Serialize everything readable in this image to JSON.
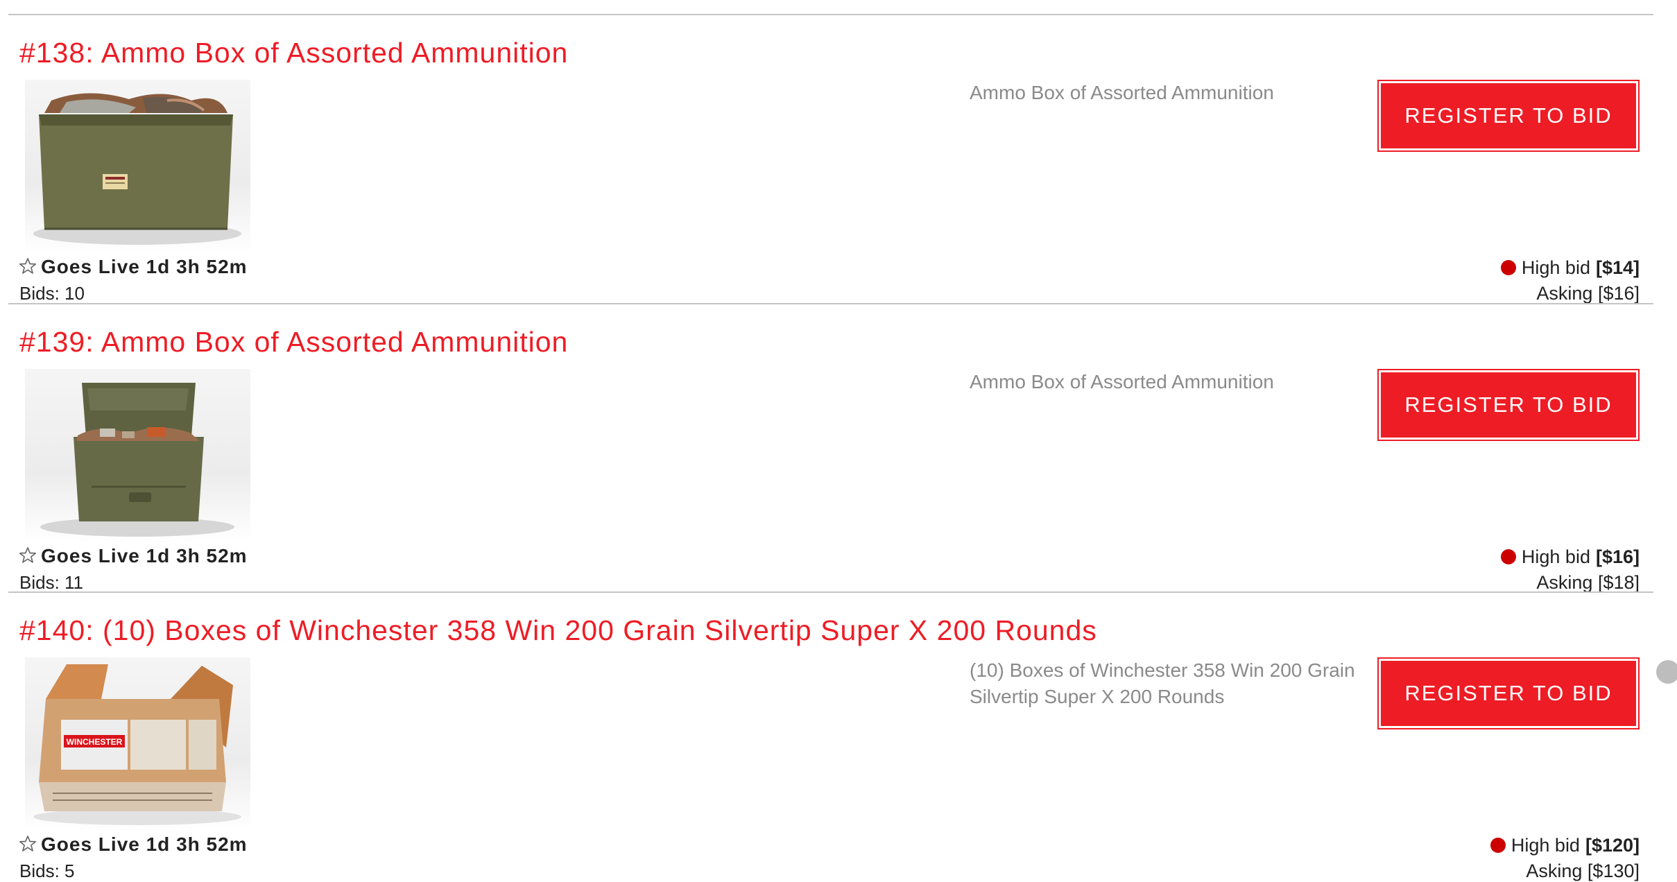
{
  "lots": [
    {
      "title": "#138: Ammo Box of Assorted Ammunition",
      "description": "Ammo Box of Assorted Ammunition",
      "register_label": "Register to Bid",
      "goes_live": "Goes Live 1d 3h 52m",
      "bids": "Bids: 10",
      "high_bid_label": "High bid",
      "high_bid_value": "[$14]",
      "asking": "Asking [$16]",
      "image": "closed-ammo-box-photo"
    },
    {
      "title": "#139: Ammo Box of Assorted Ammunition",
      "description": "Ammo Box of Assorted Ammunition",
      "register_label": "Register to Bid",
      "goes_live": "Goes Live 1d 3h 52m",
      "bids": "Bids: 11",
      "high_bid_label": "High bid",
      "high_bid_value": "[$16]",
      "asking": "Asking [$18]",
      "image": "open-ammo-box-photo"
    },
    {
      "title": "#140: (10) Boxes of Winchester 358 Win 200 Grain Silvertip Super X 200 Rounds",
      "description": "(10) Boxes of Winchester 358 Win 200 Grain Silvertip Super X 200 Rounds",
      "register_label": "Register to Bid",
      "goes_live": "Goes Live 1d 3h 52m",
      "bids": "Bids: 5",
      "high_bid_label": "High bid",
      "high_bid_value": "[$120]",
      "asking": "Asking [$130]",
      "image": "winchester-cartridge-boxes-photo",
      "image_brand_text": "WINCHESTER"
    }
  ],
  "icons": {
    "watch": "star-outline-icon",
    "status": "red-dot-icon"
  },
  "colors": {
    "accent": "#ee1c25",
    "status_dot": "#cc0000",
    "description": "#8a8a8a",
    "divider": "#c4c4c4"
  }
}
